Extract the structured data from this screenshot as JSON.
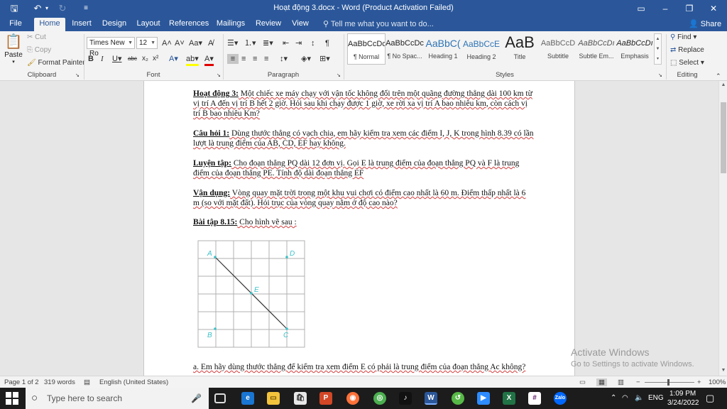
{
  "titlebar": {
    "title": "Hoạt động 3.docx - Word (Product Activation Failed)",
    "ribbon_display_icon": "ribbon-display-options-icon",
    "minimize": "–",
    "restore": "❐",
    "close": "✕"
  },
  "tabs": [
    "File",
    "Home",
    "Insert",
    "Design",
    "Layout",
    "References",
    "Mailings",
    "Review",
    "View"
  ],
  "tell_me": "Tell me what you want to do...",
  "share": "Share",
  "clipboard": {
    "paste": "Paste",
    "cut": "Cut",
    "copy": "Copy",
    "format_painter": "Format Painter",
    "label": "Clipboard"
  },
  "font": {
    "name": "Times New Ro",
    "size": "12",
    "label": "Font"
  },
  "paragraph": {
    "label": "Paragraph"
  },
  "styles": {
    "label": "Styles",
    "items": [
      {
        "preview": "AaBbCcDc",
        "name": "¶ Normal"
      },
      {
        "preview": "AaBbCcDc",
        "name": "¶ No Spac..."
      },
      {
        "preview": "AaBbC(",
        "name": "Heading 1"
      },
      {
        "preview": "AaBbCcE",
        "name": "Heading 2"
      },
      {
        "preview": "AaB",
        "name": "Title"
      },
      {
        "preview": "AaBbCcD",
        "name": "Subtitle"
      },
      {
        "preview": "AaBbCcDı",
        "name": "Subtle Em..."
      },
      {
        "preview": "AaBbCcDı",
        "name": "Emphasis"
      }
    ]
  },
  "editing": {
    "find": "Find",
    "replace": "Replace",
    "select": "Select",
    "label": "Editing"
  },
  "document": {
    "p1_label": "Hoạt động 3:",
    "p1_text": " Một chiếc xe máy chạy với vận tốc không đổi trên một quãng đường thẳng dài 100 km từ vị trí A đến vị trí B hết 2 giờ. Hỏi sau khi chạy được 1 giờ, xe rời xa vị trí A bao nhiêu km, còn cách vị trí B bao nhiêu Km?",
    "p2_label": "Câu hỏi 1:",
    "p2_text": " Dùng thước thẳng có vạch chia, em hãy kiểm tra xem các điểm I, J, K trong hình 8.39 có lần lượt là trung điểm của AB, CD, EF hay không.",
    "p3_label": "Luyện tập:",
    "p3_text": " Cho đoạn thẳng PQ dài 12 đơn vị. Gọi E là trung điểm của đoạn thẳng PQ và F là trung điểm của đoạn thẳng PE. Tính độ dài đoạn thẳng EF",
    "p4_label": "Vận dụng:",
    "p4_text": " Vòng quay mặt trời trong một khu vui chơi có điểm cao nhất là 60 m. Điểm thấp nhất là 6 m (so với mặt đất). Hỏi trục của vòng quay nằm ở độ cao nào?",
    "p5_label": "Bài tập 8.15:",
    "p5_text": " Cho hình vẽ sau :",
    "p6_text": " a. Em hãy dùng thước thẳng để kiểm tra xem điểm E có phải là trung điểm của đoạn thẳng Ac không?",
    "figure_points": {
      "A": "A",
      "D": "D",
      "E": "E",
      "B": "B",
      "C": "C"
    }
  },
  "watermark": {
    "title": "Activate Windows",
    "subtitle": "Go to Settings to activate Windows."
  },
  "status": {
    "page": "Page 1 of 2",
    "words": "319 words",
    "language": "English (United States)",
    "zoom": "100%"
  },
  "taskbar": {
    "search_placeholder": "Type here to search",
    "language": "ENG",
    "time": "1:09 PM",
    "date": "3/24/2022",
    "apps": [
      "task-view-icon",
      "edge-icon",
      "file-explorer-icon",
      "store-icon",
      "powerpoint-icon",
      "firefox-icon",
      "chrome-icon",
      "tiktok-icon",
      "word-icon",
      "app-icon",
      "zoom-icon",
      "excel-icon",
      "slack-icon",
      "zalo-icon"
    ]
  }
}
